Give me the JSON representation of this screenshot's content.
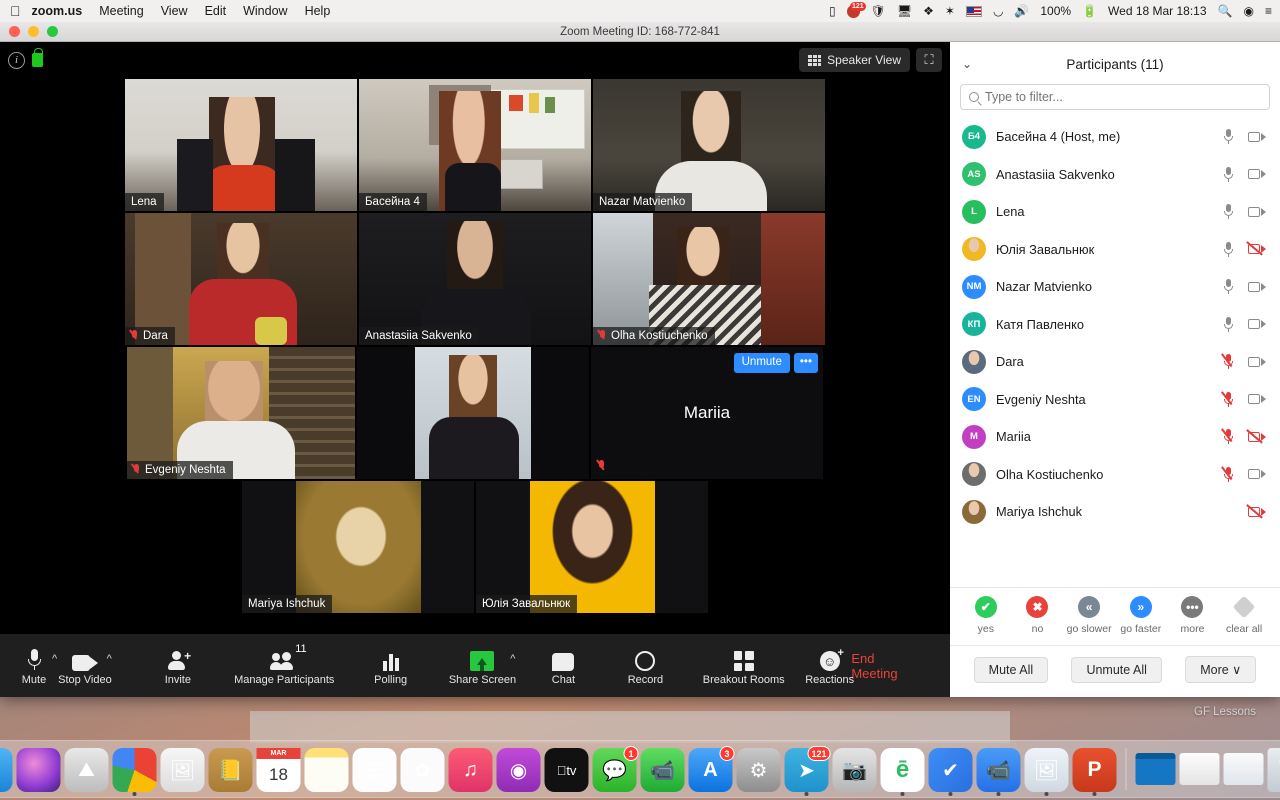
{
  "menubar": {
    "apple": "apple-logo",
    "items": [
      {
        "label": "zoom.us",
        "bold": true
      },
      {
        "label": "Meeting",
        "bold": false
      },
      {
        "label": "View",
        "bold": false
      },
      {
        "label": "Edit",
        "bold": false
      },
      {
        "label": "Window",
        "bold": false
      },
      {
        "label": "Help",
        "bold": false
      }
    ],
    "status": {
      "battery_pct": "100%",
      "datetime": "Wed 18 Mar  18:13",
      "telegram_badge": "121"
    }
  },
  "window": {
    "title": "Zoom Meeting ID: 168-772-841"
  },
  "header": {
    "view_label": "Speaker View"
  },
  "video_grid": {
    "rows": [
      [
        {
          "name": "Lena",
          "muted": false,
          "active": false,
          "kind": "video"
        },
        {
          "name": "Басейна 4",
          "muted": false,
          "active": true,
          "kind": "video"
        },
        {
          "name": "Nazar Matvienko",
          "muted": false,
          "active": false,
          "kind": "video"
        }
      ],
      [
        {
          "name": "Dara",
          "muted": true,
          "active": false,
          "kind": "video"
        },
        {
          "name": "Anastasiia Sakvenko",
          "muted": false,
          "active": false,
          "kind": "video"
        },
        {
          "name": "Olha Kostiuchenko",
          "muted": true,
          "active": false,
          "kind": "video"
        }
      ],
      [
        {
          "name": "Evgeniy Neshta",
          "muted": true,
          "active": false,
          "kind": "video"
        },
        {
          "name": "",
          "muted": false,
          "active": false,
          "kind": "video"
        },
        {
          "name": "Mariia",
          "muted": true,
          "active": false,
          "kind": "name-only",
          "unmute_label": "Unmute",
          "more_label": "•••"
        }
      ],
      [
        {
          "name": "Mariya Ishchuk",
          "muted": false,
          "active": false,
          "kind": "photo"
        },
        {
          "name": "Юлія Завальнюк",
          "muted": false,
          "active": false,
          "kind": "photo"
        }
      ]
    ]
  },
  "panel": {
    "title": "Participants (11)",
    "filter_placeholder": "Type to filter...",
    "filter_value": "",
    "participants": [
      {
        "name": "Басейна 4 (Host, me)",
        "initials": "Б4",
        "avatar_color": "#19b98e",
        "avatar_kind": "initials",
        "mic": "on",
        "cam": "on"
      },
      {
        "name": "Anastasiia Sakvenko",
        "initials": "AS",
        "avatar_color": "#2ec06c",
        "avatar_kind": "initials",
        "mic": "on",
        "cam": "on"
      },
      {
        "name": "Lena",
        "initials": "L",
        "avatar_color": "#28bd5f",
        "avatar_kind": "initials",
        "mic": "on",
        "cam": "on"
      },
      {
        "name": "Юлія Завальнюк",
        "initials": "",
        "avatar_color": "#f0b823",
        "avatar_kind": "photo",
        "mic": "on",
        "cam": "off"
      },
      {
        "name": "Nazar Matvienko",
        "initials": "NM",
        "avatar_color": "#2d8cff",
        "avatar_kind": "initials",
        "mic": "on",
        "cam": "on"
      },
      {
        "name": "Катя Павленко",
        "initials": "КП",
        "avatar_color": "#17b39b",
        "avatar_kind": "initials",
        "mic": "on",
        "cam": "on"
      },
      {
        "name": "Dara",
        "initials": "",
        "avatar_color": "#5a6b7d",
        "avatar_kind": "photo",
        "mic": "off",
        "cam": "on"
      },
      {
        "name": "Evgeniy Neshta",
        "initials": "EN",
        "avatar_color": "#2d8cff",
        "avatar_kind": "initials",
        "mic": "off",
        "cam": "on"
      },
      {
        "name": "Mariia",
        "initials": "M",
        "avatar_color": "#c23ec2",
        "avatar_kind": "initials",
        "mic": "off",
        "cam": "off"
      },
      {
        "name": "Olha Kostiuchenko",
        "initials": "",
        "avatar_color": "#6d6d6d",
        "avatar_kind": "photo",
        "mic": "off",
        "cam": "on"
      },
      {
        "name": "Mariya Ishchuk",
        "initials": "",
        "avatar_color": "#8a6a3a",
        "avatar_kind": "photo",
        "mic": "none",
        "cam": "off"
      }
    ],
    "reactions": [
      {
        "label": "yes",
        "glyph": "✔",
        "color": "#2ecc5c",
        "shape": "circle"
      },
      {
        "label": "no",
        "glyph": "✖",
        "color": "#e8433a",
        "shape": "circle"
      },
      {
        "label": "go slower",
        "glyph": "«",
        "color": "#7a8794",
        "shape": "circle"
      },
      {
        "label": "go faster",
        "glyph": "»",
        "color": "#2d8cff",
        "shape": "circle"
      },
      {
        "label": "more",
        "glyph": "•••",
        "color": "#7a7a7a",
        "shape": "circle"
      },
      {
        "label": "clear all",
        "glyph": "",
        "color": "#cfcfcf",
        "shape": "diamond"
      }
    ],
    "actions": [
      {
        "label": "Mute All"
      },
      {
        "label": "Unmute All"
      },
      {
        "label": "More ∨"
      }
    ]
  },
  "toolbar": {
    "items": [
      {
        "label": "Mute",
        "icon": "microphone-icon",
        "caret": true
      },
      {
        "label": "Stop Video",
        "icon": "camera-icon",
        "caret": true
      },
      {
        "label": "Invite",
        "icon": "add-person-icon",
        "caret": false
      },
      {
        "label": "Manage Participants",
        "icon": "people-icon",
        "caret": false,
        "badge": "11"
      },
      {
        "label": "Polling",
        "icon": "bar-chart-icon",
        "caret": false
      },
      {
        "label": "Share Screen",
        "icon": "share-screen-icon",
        "caret": true
      },
      {
        "label": "Chat",
        "icon": "chat-bubble-icon",
        "caret": false
      },
      {
        "label": "Record",
        "icon": "record-circle-icon",
        "caret": false
      },
      {
        "label": "Breakout Rooms",
        "icon": "grid-squares-icon",
        "caret": false
      },
      {
        "label": "Reactions",
        "icon": "smiley-plus-icon",
        "caret": false
      }
    ],
    "end_label": "End Meeting"
  },
  "desktop": {
    "bg_window_label": "GF Lessons",
    "dock": [
      {
        "name": "finder",
        "glyph": "☺",
        "bg": "linear-gradient(to bottom,#4fb5f5,#1a84d8)",
        "running": true
      },
      {
        "name": "siri",
        "glyph": "",
        "bg": "radial-gradient(circle at 40% 35%,#f08bd8,#8e3bd4 60%,#3b2370)",
        "running": false
      },
      {
        "name": "launchpad",
        "glyph": "⛰",
        "bg": "linear-gradient(to bottom,#e9e9e9,#bdbdbd)",
        "running": false
      },
      {
        "name": "chrome",
        "glyph": "",
        "bg": "conic-gradient(#ea4335 0 33%,#fbbc05 0 55%,#34a853 0 78%,#4285f4 0 100%)",
        "running": true
      },
      {
        "name": "preview",
        "glyph": "🖼",
        "bg": "linear-gradient(to bottom,#f6f6f6,#dcdcdc)",
        "running": false
      },
      {
        "name": "contacts",
        "glyph": "📒",
        "bg": "linear-gradient(to bottom,#c89a52,#a97c35)",
        "running": false
      },
      {
        "name": "calendar",
        "glyph": "18",
        "bg": "#ffffff",
        "running": false
      },
      {
        "name": "notes",
        "glyph": "",
        "bg": "linear-gradient(to bottom,#ffe177 0 22%,#fdfdf6 22%)",
        "running": false
      },
      {
        "name": "reminders",
        "glyph": "☰",
        "bg": "#fdfdfd",
        "running": false
      },
      {
        "name": "photos",
        "glyph": "✿",
        "bg": "#fbfbfb",
        "running": false
      },
      {
        "name": "music",
        "glyph": "♫",
        "bg": "linear-gradient(to bottom,#fb5c74,#e0336a)",
        "running": false
      },
      {
        "name": "podcasts",
        "glyph": "◉",
        "bg": "linear-gradient(to bottom,#c24bd8,#8e2bb5)",
        "running": false
      },
      {
        "name": "apple-tv",
        "glyph": "tv",
        "bg": "#111111",
        "running": false
      },
      {
        "name": "messages",
        "glyph": "💬",
        "bg": "linear-gradient(to bottom,#63d85b,#2bb32b)",
        "running": false,
        "badge": "1"
      },
      {
        "name": "facetime",
        "glyph": "📹",
        "bg": "linear-gradient(to bottom,#5fdd62,#1faa35)",
        "running": false
      },
      {
        "name": "app-store",
        "glyph": "A",
        "bg": "linear-gradient(to bottom,#4fa8f8,#0a72e0)",
        "running": false,
        "badge": "3"
      },
      {
        "name": "system-preferences",
        "glyph": "⚙",
        "bg": "linear-gradient(to bottom,#c9c9c9,#8d8d8d)",
        "running": false
      },
      {
        "name": "telegram",
        "glyph": "➤",
        "bg": "linear-gradient(to bottom,#40b3e0,#1e92cc)",
        "running": true,
        "badge": "121"
      },
      {
        "name": "image-capture",
        "glyph": "📷",
        "bg": "linear-gradient(to bottom,#e4e4e4,#b6b6b6)",
        "running": false
      },
      {
        "name": "evernote",
        "glyph": "ē",
        "bg": "#ffffff",
        "running": true
      },
      {
        "name": "todoist",
        "glyph": "✔",
        "bg": "linear-gradient(135deg,#3f8ef5,#2a6fe0)",
        "running": true
      },
      {
        "name": "zoom",
        "glyph": "📹",
        "bg": "linear-gradient(to bottom,#4a9bf7,#2670e8)",
        "running": true
      },
      {
        "name": "preview-2",
        "glyph": "🖼",
        "bg": "linear-gradient(to bottom,#eef3f8,#cfd8e2)",
        "running": true
      },
      {
        "name": "powerpoint",
        "glyph": "P",
        "bg": "linear-gradient(to bottom,#e8512e,#c8381c)",
        "running": true
      }
    ],
    "minimized": [
      {
        "name": "minimized-window-1"
      },
      {
        "name": "minimized-window-2"
      },
      {
        "name": "minimized-window-3"
      }
    ],
    "trash": {
      "name": "trash"
    }
  }
}
